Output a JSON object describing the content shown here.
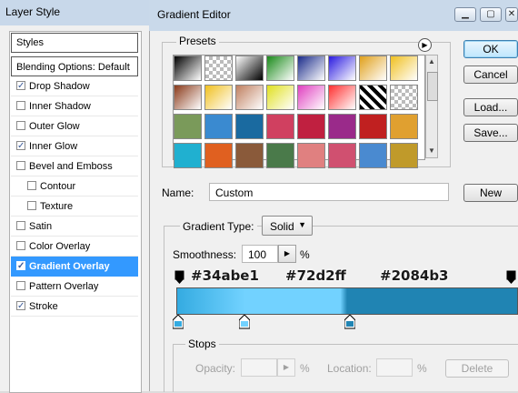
{
  "layer_style": {
    "title": "Layer Style",
    "styles_header": "Styles",
    "blending_options": "Blending Options: Default",
    "effects": [
      {
        "label": "Drop Shadow",
        "checked": true,
        "indent": false
      },
      {
        "label": "Inner Shadow",
        "checked": false,
        "indent": false
      },
      {
        "label": "Outer Glow",
        "checked": false,
        "indent": false
      },
      {
        "label": "Inner Glow",
        "checked": true,
        "indent": false
      },
      {
        "label": "Bevel and Emboss",
        "checked": false,
        "indent": false
      },
      {
        "label": "Contour",
        "checked": false,
        "indent": true
      },
      {
        "label": "Texture",
        "checked": false,
        "indent": true
      },
      {
        "label": "Satin",
        "checked": false,
        "indent": false
      },
      {
        "label": "Color Overlay",
        "checked": false,
        "indent": false
      },
      {
        "label": "Gradient Overlay",
        "checked": true,
        "indent": false,
        "selected": true
      },
      {
        "label": "Pattern Overlay",
        "checked": false,
        "indent": false
      },
      {
        "label": "Stroke",
        "checked": true,
        "indent": false
      }
    ]
  },
  "gradient_editor": {
    "title": "Gradient Editor",
    "presets_label": "Presets",
    "buttons": {
      "ok": "OK",
      "cancel": "Cancel",
      "load": "Load...",
      "save": "Save...",
      "new": "New"
    },
    "name_label": "Name:",
    "name_value": "Custom",
    "gradient_type_label": "Gradient Type:",
    "gradient_type_value": "Solid",
    "smoothness_label": "Smoothness:",
    "smoothness_value": "100",
    "percent": "%",
    "color_labels": [
      "#34abe1",
      "#72d2ff",
      "#2084b3"
    ],
    "gradient_colors": {
      "start": "#34abe1",
      "mid": "#72d2ff",
      "end": "#2084b3"
    },
    "stops_label": "Stops",
    "opacity_label": "Opacity:",
    "location_label": "Location:",
    "percent_opacity": "%",
    "percent_location": "%",
    "delete_label": "Delete",
    "presets": [
      [
        "#000000",
        "#8a8a8a",
        "#ffffff",
        "#1a8a1a",
        "#1a2b8a",
        "#2a1ae0",
        "#e0a01a",
        "#f0c020"
      ],
      [
        "#8a3a1a",
        "#f0c020",
        "#c08060",
        "#e0e020",
        "#e040c0",
        "#ff3030",
        "#202020",
        "#c0c0c0"
      ],
      [
        "#7a9a5a",
        "#3a8ad0",
        "#1a6aa0",
        "#d04060",
        "#c02040",
        "#9a2a8a",
        "#c02020",
        "#e0a030"
      ],
      [
        "#20b0d0",
        "#e06020",
        "#8a5a3a",
        "#4a7a4a",
        "#e08080",
        "#d05070",
        "#4a8ad0",
        "#c09a2a"
      ]
    ]
  }
}
